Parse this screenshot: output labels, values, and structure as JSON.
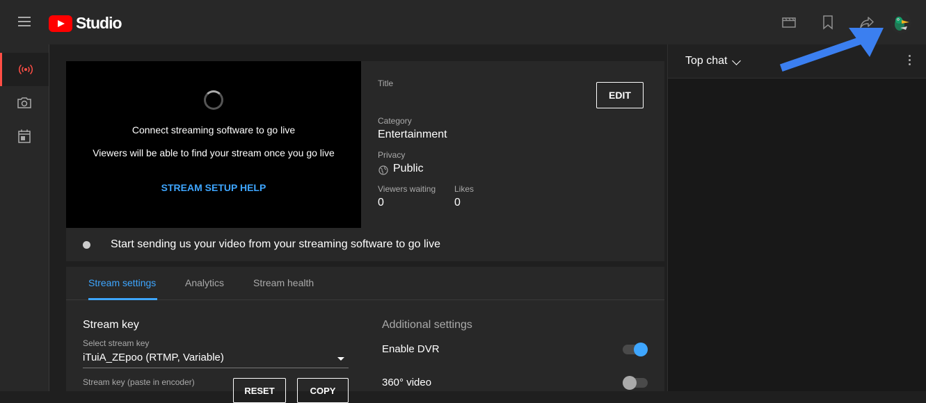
{
  "header": {
    "logo_text": "Studio",
    "icons": [
      "hamburger-menu-icon",
      "clapperboard-icon",
      "bookmark-icon",
      "share-icon",
      "avatar"
    ]
  },
  "sidebar": {
    "items": [
      {
        "icon": "live-broadcast-icon",
        "active": true
      },
      {
        "icon": "camera-icon",
        "active": false
      },
      {
        "icon": "calendar-icon",
        "active": false
      }
    ]
  },
  "preview": {
    "line1": "Connect streaming software to go live",
    "line2": "Viewers will be able to find your stream once you go live",
    "help_link": "STREAM SETUP HELP"
  },
  "details": {
    "title_label": "Title",
    "title_value": "",
    "edit_label": "EDIT",
    "category_label": "Category",
    "category_value": "Entertainment",
    "privacy_label": "Privacy",
    "privacy_value": "Public",
    "viewers_label": "Viewers waiting",
    "viewers_value": "0",
    "likes_label": "Likes",
    "likes_value": "0"
  },
  "status": {
    "text": "Start sending us your video from your streaming software to go live"
  },
  "settings": {
    "tabs": [
      {
        "label": "Stream settings",
        "active": true
      },
      {
        "label": "Analytics",
        "active": false
      },
      {
        "label": "Stream health",
        "active": false
      }
    ],
    "stream_key_title": "Stream key",
    "select_label": "Select stream key",
    "select_value": "iTuiA_ZEpoo (RTMP, Variable)",
    "paste_label": "Stream key (paste in encoder)",
    "reset_label": "RESET",
    "copy_label": "COPY",
    "additional_title": "Additional settings",
    "dvr_label": "Enable DVR",
    "dvr_on": true,
    "vr_label": "360° video",
    "vr_on": false
  },
  "chat": {
    "title": "Top chat"
  },
  "colors": {
    "accent_blue": "#3ea6ff",
    "brand_red": "#ff0000",
    "live_red": "#ff4e45",
    "annotation_arrow": "#3b7ff0"
  }
}
